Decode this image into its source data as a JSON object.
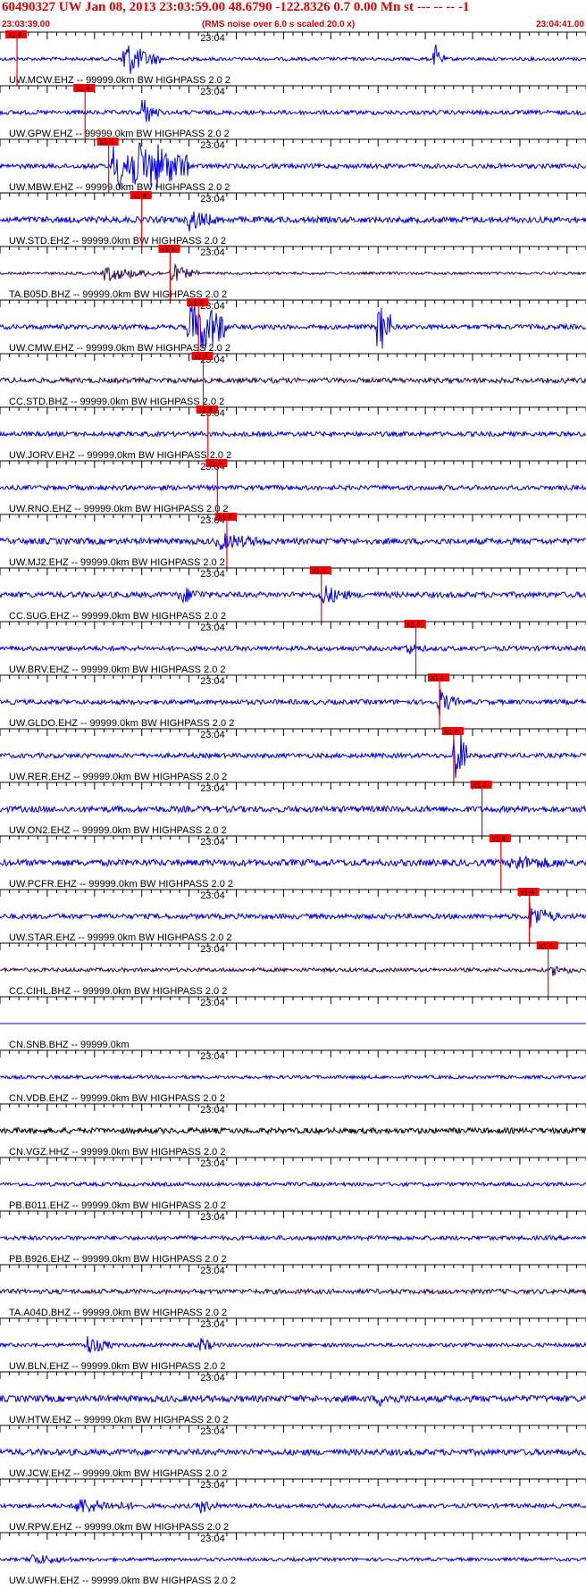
{
  "header": {
    "title": "60490327 UW Jan 08, 2013 23:03:59.00   48.6790 -122.8326  0.7 0.00 Mn st --- -- --  -1",
    "start_time": "23:03:39.00",
    "scale_note": "(RMS noise over 6.0 s scaled 20.0 x)",
    "end_time": "23:04:41.00"
  },
  "chart_data": {
    "type": "line",
    "title": "60490327 UW Jan 08, 2013 23:03:59.00   48.6790 -122.8326  0.7 0.00 Mn st --- -- --  -1",
    "x_start": "23:03:39.00",
    "x_end": "23:04:41.00",
    "x_tick_label": "23:04",
    "pick_label": "x1.4",
    "colors": {
      "trace": "#0000ee",
      "trace_dark": "#2a0a5a",
      "trace_black": "#000000",
      "pick": "#ff0000",
      "title": "#e00000"
    },
    "traces": [
      {
        "label": "UW.MCW.EHZ -- 99999.0km BW  HIGHPASS  2.0  2",
        "pick_s": 1.8,
        "color": "blue",
        "events": [
          [
            13,
            4,
            8
          ],
          [
            46,
            1,
            6
          ]
        ],
        "noise": 0.15
      },
      {
        "label": "UW.GPW.EHZ -- 99999.0km BW  HIGHPASS  2.0  2",
        "pick_s": 9.0,
        "color": "blue",
        "events": [
          [
            15,
            2,
            6
          ]
        ],
        "noise": 0.25
      },
      {
        "label": "UW.MBW.EHZ -- 99999.0km BW  HIGHPASS  2.0  2",
        "pick_s": 11.5,
        "color": "blue",
        "events": [
          [
            12,
            8,
            24
          ]
        ],
        "noise": 0.3
      },
      {
        "label": "UW.STD.EHZ -- 99999.0km BW  HIGHPASS  2.0  2",
        "pick_s": 15.0,
        "color": "blue",
        "events": [
          [
            20,
            3,
            4
          ]
        ],
        "noise": 0.45
      },
      {
        "label": "TA.B05D.BHZ -- 99999.0km BW  HIGHPASS  2.0  2",
        "pick_s": 18.0,
        "color": "dark",
        "events": [
          [
            11,
            6,
            3
          ],
          [
            18,
            3,
            4
          ]
        ],
        "noise": 0.05
      },
      {
        "label": "UW.CMW.EHZ -- 99999.0km BW  HIGHPASS  2.0  2",
        "pick_s": 21.0,
        "color": "blue",
        "events": [
          [
            20,
            4,
            24
          ],
          [
            40,
            1.5,
            24
          ]
        ],
        "noise": 0.3
      },
      {
        "label": "CC.STD.BHZ -- 99999.0km BW  HIGHPASS  2.0  2",
        "pick_s": 21.5,
        "color": "dark",
        "events": [],
        "noise": 0.35
      },
      {
        "label": "UW.JORV.EHZ -- 99999.0km BW  HIGHPASS  2.0  2",
        "pick_s": 22.0,
        "color": "blue",
        "events": [],
        "noise": 0.3
      },
      {
        "label": "UW.RNO.EHZ -- 99999.0km BW  HIGHPASS  2.0  2",
        "pick_s": 23.0,
        "color": "blue",
        "events": [],
        "noise": 0.3
      },
      {
        "label": "UW.MJ2.EHZ -- 99999.0km BW  HIGHPASS  2.0  2",
        "pick_s": 24.0,
        "color": "blue",
        "events": [
          [
            23,
            5,
            3
          ]
        ],
        "noise": 0.45
      },
      {
        "label": "CC.SUG.EHZ -- 99999.0km BW  HIGHPASS  2.0  2",
        "pick_s": 34.0,
        "color": "blue",
        "events": [
          [
            19,
            3,
            3
          ],
          [
            34,
            3,
            4
          ]
        ],
        "noise": 0.4
      },
      {
        "label": "UW.BRV.EHZ -- 99999.0km BW  HIGHPASS  2.0  2",
        "pick_s": 44.0,
        "color": "blue",
        "events": [
          [
            43,
            2,
            2
          ]
        ],
        "noise": 0.3
      },
      {
        "label": "UW.GLDO.EHZ -- 99999.0km BW  HIGHPASS  2.0  2",
        "pick_s": 46.5,
        "color": "blue",
        "events": [
          [
            46.5,
            2,
            5
          ]
        ],
        "noise": 0.3
      },
      {
        "label": "UW.RER.EHZ -- 99999.0km BW  HIGHPASS  2.0  2",
        "pick_s": 48.0,
        "color": "blue",
        "events": [
          [
            48,
            1.5,
            24
          ]
        ],
        "noise": 0.3
      },
      {
        "label": "UW.ON2.EHZ -- 99999.0km BW  HIGHPASS  2.0  2",
        "pick_s": 51.0,
        "color": "blue",
        "events": [],
        "noise": 0.45
      },
      {
        "label": "UW.PCFR.EHZ -- 99999.0km BW  HIGHPASS  2.0  2",
        "pick_s": 53.0,
        "color": "blue",
        "events": [
          [
            54,
            6,
            2.5
          ]
        ],
        "noise": 0.5
      },
      {
        "label": "UW.STAR.EHZ -- 99999.0km BW  HIGHPASS  2.0  2",
        "pick_s": 56.0,
        "color": "blue",
        "events": [
          [
            56,
            3,
            5
          ]
        ],
        "noise": 0.35
      },
      {
        "label": "CC.CIHL.BHZ -- 99999.0km BW  HIGHPASS  2.0  2",
        "pick_s": 58.0,
        "color": "dark",
        "events": [
          [
            58.5,
            3,
            1.6
          ]
        ],
        "noise": 0.2
      },
      {
        "label": "CN.SNB.BHZ -- 99999.0km",
        "pick_s": null,
        "color": "blue",
        "events": [],
        "noise": 0,
        "flat": true
      },
      {
        "label": "CN.VDB.EHZ -- 99999.0km BW  HIGHPASS  2.0  2",
        "pick_s": null,
        "color": "blue",
        "events": [],
        "noise": 0.15
      },
      {
        "label": "CN.VGZ.HHZ -- 99999.0km BW  HIGHPASS  2.0  2",
        "pick_s": null,
        "color": "black",
        "events": [],
        "noise": 0.4
      },
      {
        "label": "PB.B011.EHZ -- 99999.0km BW  HIGHPASS  2.0  2",
        "pick_s": null,
        "color": "blue",
        "events": [],
        "noise": 0.2
      },
      {
        "label": "PB.B926.EHZ -- 99999.0km BW  HIGHPASS  2.0  2",
        "pick_s": null,
        "color": "blue",
        "events": [],
        "noise": 0.25
      },
      {
        "label": "TA.A04D.BHZ -- 99999.0km BW  HIGHPASS  2.0  2",
        "pick_s": null,
        "color": "dark",
        "events": [],
        "noise": 0.3
      },
      {
        "label": "UW.BLN.EHZ -- 99999.0km BW  HIGHPASS  2.0  2",
        "pick_s": null,
        "color": "blue",
        "events": [
          [
            9,
            3,
            4
          ],
          [
            21,
            2,
            3
          ]
        ],
        "noise": 0.2
      },
      {
        "label": "UW.HTW.EHZ -- 99999.0km BW  HIGHPASS  2.0  2",
        "pick_s": null,
        "color": "blue",
        "events": [
          [
            40,
            3,
            2
          ]
        ],
        "noise": 0.5
      },
      {
        "label": "UW.JCW.EHZ -- 99999.0km BW  HIGHPASS  2.0  2",
        "pick_s": null,
        "color": "blue",
        "events": [],
        "noise": 0.45
      },
      {
        "label": "UW.RPW.EHZ -- 99999.0km BW  HIGHPASS  2.0  2",
        "pick_s": null,
        "color": "blue",
        "events": [
          [
            8,
            6,
            3
          ],
          [
            21,
            2,
            3
          ]
        ],
        "noise": 0.25
      },
      {
        "label": "UW.UWFH.EHZ -- 99999.0km BW  HIGHPASS  2.0  2",
        "pick_s": null,
        "color": "blue",
        "events": [
          [
            3,
            5,
            2
          ]
        ],
        "noise": 0.15
      }
    ]
  }
}
